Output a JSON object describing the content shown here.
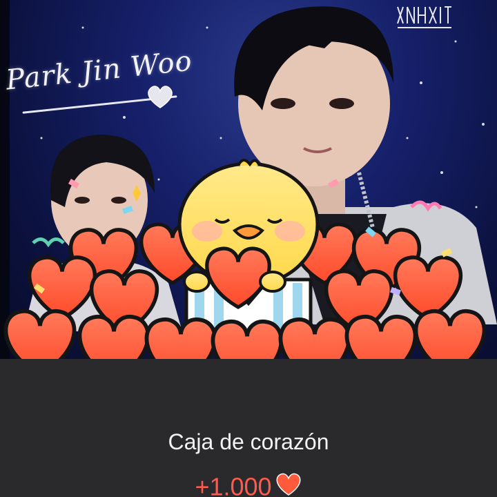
{
  "overlay_image_text": "Park Jin Woo",
  "reward_card": {
    "title": "Caja de corazón",
    "amount": "+1.000",
    "currency_icon": "heart-icon"
  },
  "colors": {
    "panel_bg": "#2a2a2c",
    "amount_color": "#ff5a4e",
    "title_color": "#f2f2f2",
    "heart_fill": "#ff5a3c",
    "heart_outline": "#1a1a1a"
  }
}
